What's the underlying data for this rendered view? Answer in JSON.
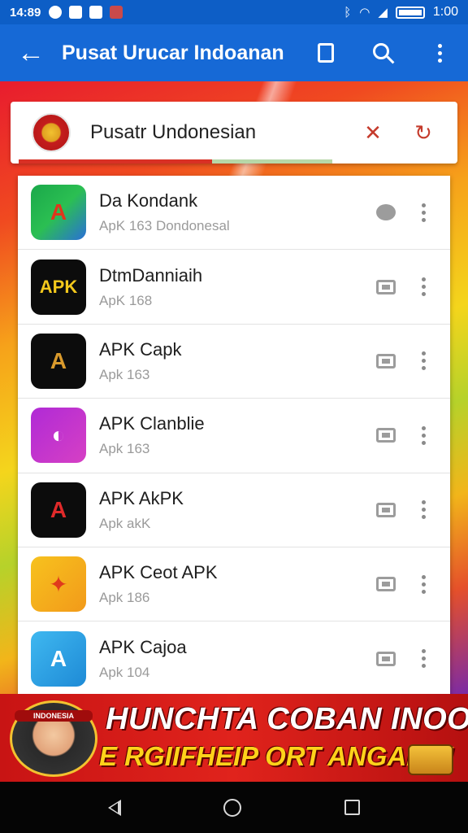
{
  "status_bar": {
    "time_left": "14:89",
    "time_right": "1:00",
    "icons": [
      "notification-icon",
      "notification-icon",
      "notification-icon",
      "notification-icon",
      "bluetooth-icon",
      "wifi-icon",
      "signal-icon",
      "battery-icon"
    ]
  },
  "toolbar": {
    "back_glyph": "←",
    "title": "Pusat Urucar Indoanan"
  },
  "header": {
    "title": "Pusatr Undonesian",
    "accent_red": "#d93025",
    "accent_green": "#b7d7a8"
  },
  "apps": [
    {
      "name": "Da Kondank",
      "subtitle": "ApK 163 Dondonesal",
      "icon_text": "A",
      "icon_bg": "linear-gradient(135deg,#1aa84a 0%,#2bbf52 50%,#2a6fd8 100%)",
      "icon_color": "#e0351c",
      "action": "chat"
    },
    {
      "name": "DtmDanniaih",
      "subtitle": "ApK 168",
      "icon_text": "APK",
      "icon_bg": "#0c0c0c",
      "icon_color": "#f3c81c",
      "action": "store"
    },
    {
      "name": "APK Capk",
      "subtitle": "Apk 163",
      "icon_text": "A",
      "icon_bg": "#0c0c0c",
      "icon_color": "#d99a2c",
      "action": "store"
    },
    {
      "name": "APK Clanblie",
      "subtitle": "Apk 163",
      "icon_text": "◐",
      "icon_bg": "linear-gradient(135deg,#b02ad6 0%,#d640c4 100%)",
      "icon_color": "#ffffff",
      "action": "store"
    },
    {
      "name": "APK AkPK",
      "subtitle": "Apk akK",
      "icon_text": "A",
      "icon_bg": "#0c0c0c",
      "icon_color": "#e02a2a",
      "action": "store"
    },
    {
      "name": "APK Ceot APK",
      "subtitle": "Apk 186",
      "icon_text": "✦",
      "icon_bg": "linear-gradient(135deg,#f7c21e 0%,#f29a1a 100%)",
      "icon_color": "#e03a1c",
      "action": "store"
    },
    {
      "name": "APK Cajoa",
      "subtitle": "Apk 104",
      "icon_text": "A",
      "icon_bg": "linear-gradient(135deg,#3fb8f0 0%,#1e8ad6 100%)",
      "icon_color": "#ffffff",
      "action": "store"
    }
  ],
  "banner": {
    "mascot_label": "INDONESIA",
    "line1": "HUNCHTA COBAN INOOMI!",
    "line2": "E RGIIFHEIP ORT ANGANK!"
  },
  "colors": {
    "toolbar_bg": "#1669d6",
    "status_bg": "#0d5ec6",
    "banner_bg": "#e0231c"
  }
}
